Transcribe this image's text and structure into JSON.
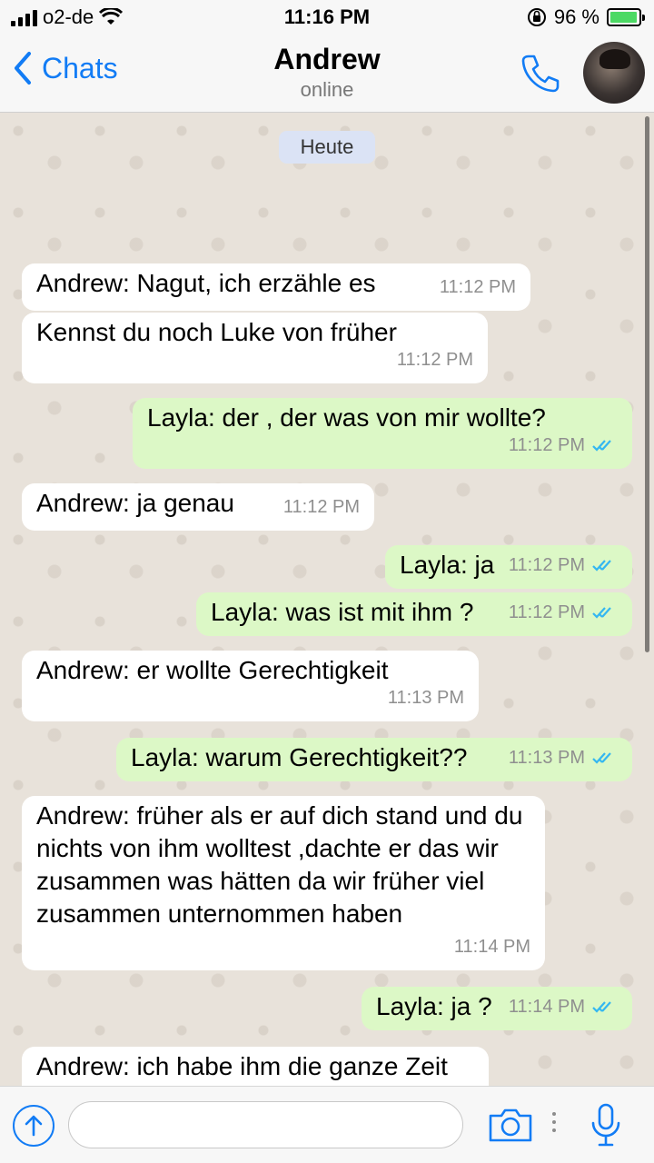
{
  "status_bar": {
    "carrier": "o2-de",
    "time": "11:16 PM",
    "battery_percent": "96 %",
    "battery_level": 0.96
  },
  "header": {
    "back_label": "Chats",
    "contact_name": "Andrew",
    "contact_status": "online"
  },
  "chat": {
    "day_label": "Heute",
    "messages": [
      {
        "side": "in",
        "text": "Andrew: Nagut, ich erzähle es",
        "time": "11:12 PM"
      },
      {
        "side": "in",
        "text": "Kennst du noch Luke von früher",
        "time": "11:12 PM"
      },
      {
        "side": "out",
        "text": "Layla: der , der was von mir wollte?",
        "time": "11:12 PM",
        "read": true
      },
      {
        "side": "in",
        "text": "Andrew: ja genau",
        "time": "11:12 PM"
      },
      {
        "side": "out",
        "text": "Layla: ja",
        "time": "11:12 PM",
        "read": true
      },
      {
        "side": "out",
        "text": "Layla: was ist mit ihm ?",
        "time": "11:12 PM",
        "read": true
      },
      {
        "side": "in",
        "text": "Andrew: er wollte Gerechtigkeit",
        "time": "11:13 PM"
      },
      {
        "side": "out",
        "text": "Layla: warum Gerechtigkeit??",
        "time": "11:13 PM",
        "read": true
      },
      {
        "side": "in",
        "text": "Andrew: früher als er auf dich stand und du nichts von ihm wolltest ,dachte er das wir zusammen was hätten da wir früher viel zusammen unternommen haben",
        "time": "11:14 PM"
      },
      {
        "side": "out",
        "text": "Layla: ja ?",
        "time": "11:14 PM",
        "read": true
      },
      {
        "side": "in",
        "text": "Andrew: ich habe ihm die ganze Zeit",
        "time": ""
      }
    ]
  },
  "input": {
    "placeholder": ""
  },
  "colors": {
    "accent": "#127cf5",
    "outgoing_bubble": "#dcf8c6",
    "incoming_bubble": "#ffffff",
    "read_ticks": "#34b7f1"
  }
}
